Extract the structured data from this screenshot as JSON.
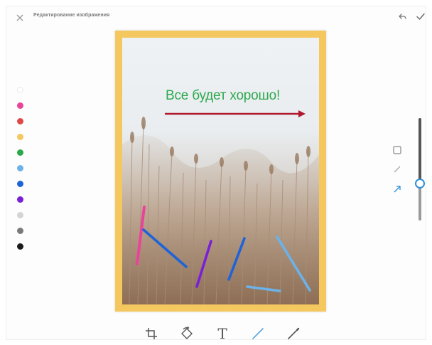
{
  "header": {
    "title": "Редактирование изображения",
    "close_icon": "close-icon",
    "undo_icon": "undo-icon",
    "confirm_icon": "check-icon"
  },
  "palette": {
    "colors": [
      "#ffffff",
      "#e8449a",
      "#e04848",
      "#f4c75f",
      "#2aa84a",
      "#6cb2e8",
      "#1f63d8",
      "#7a1fd8",
      "#d4d4d4",
      "#7a7a7a",
      "#1a1a1a"
    ]
  },
  "canvas": {
    "border_color": "#f4c75f",
    "text_annotation": "Все будет хорошо!",
    "text_color": "#2fa84f",
    "arrow_color": "#b0182e"
  },
  "side_tools": [
    "rectangle-icon",
    "line-icon",
    "arrow-icon"
  ],
  "active_side_tool": "arrow-icon",
  "bottom_toolbar": {
    "tools": [
      "crop-icon",
      "rotate-icon",
      "text-tool",
      "line-tool",
      "pen-tool"
    ],
    "text_label": "T",
    "active_tool": "line-tool"
  },
  "brush_size": {
    "level": 0.36
  }
}
